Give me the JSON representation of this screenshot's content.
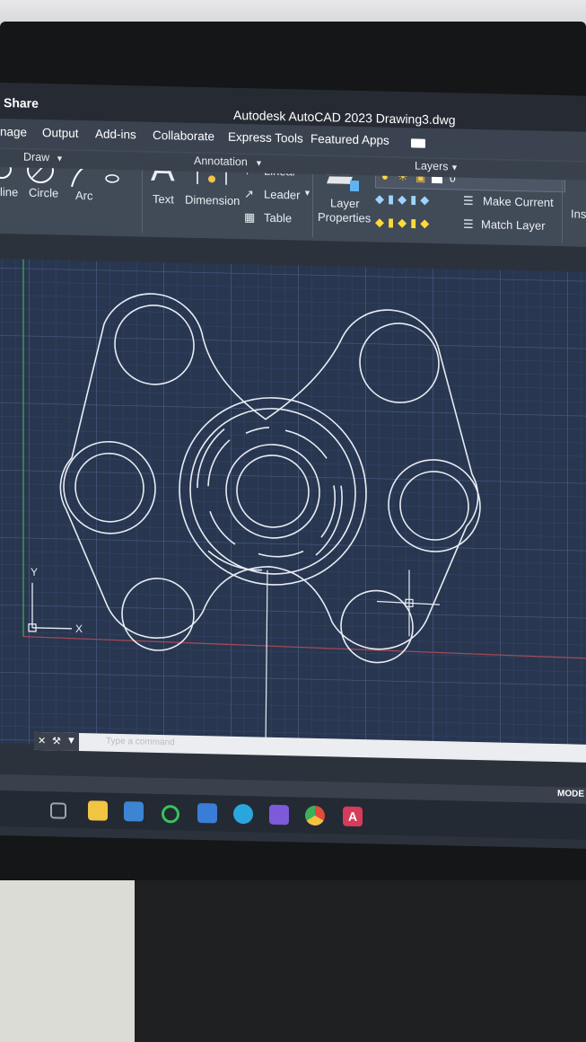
{
  "titlebar": {
    "share": "Share",
    "title": "Autodesk AutoCAD 2023  Drawing3.dwg"
  },
  "menu": [
    "nage",
    "Output",
    "Add-ins",
    "Collaborate",
    "Express Tools",
    "Featured Apps"
  ],
  "ribbon": {
    "draw": {
      "line": "line",
      "circle": "Circle",
      "arc": "Arc",
      "panel": "Draw"
    },
    "annotation": {
      "text": "Text",
      "dimension": "Dimension",
      "linear": "Linear",
      "leader": "Leader",
      "table": "Table",
      "panel": "Annotation"
    },
    "layers": {
      "layer_properties_1": "Layer",
      "layer_properties_2": "Properties",
      "make_current": "Make Current",
      "match_layer": "Match Layer",
      "current_layer": "0",
      "panel": "Layers"
    },
    "insert": "Ins"
  },
  "drawing": {
    "ucs": {
      "y": "Y",
      "x": "X"
    },
    "background": "#283650",
    "line_color": "#e8ecf3"
  },
  "command": {
    "placeholder": "Type a command"
  },
  "status": {
    "model": "MODE"
  },
  "taskbar": {
    "icons": [
      "task-view-icon",
      "file-explorer-icon",
      "store-icon",
      "cortana-icon",
      "terminal-icon",
      "edge-icon",
      "visual-studio-icon",
      "chrome-icon",
      "autocad-icon"
    ]
  }
}
